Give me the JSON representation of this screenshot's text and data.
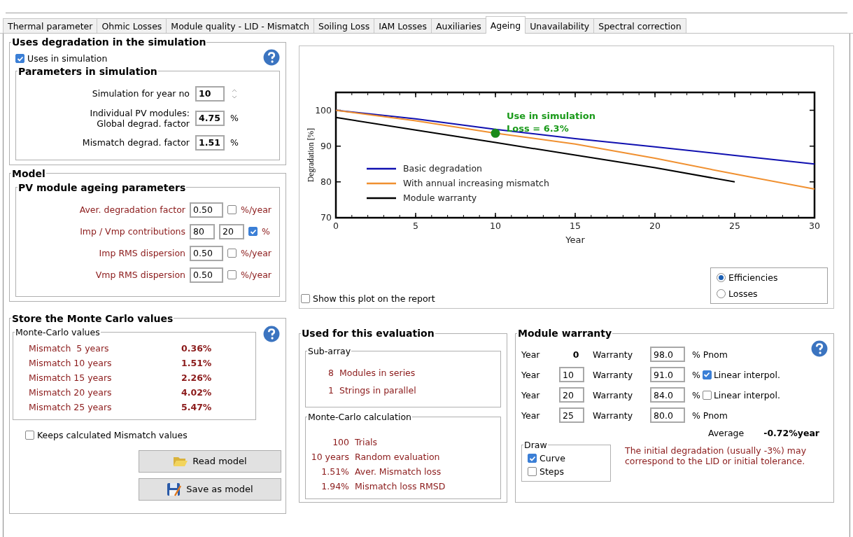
{
  "tabs": [
    {
      "label": "Thermal parameter",
      "selected": false
    },
    {
      "label": "Ohmic Losses",
      "selected": false
    },
    {
      "label": "Module quality - LID - Mismatch",
      "selected": false
    },
    {
      "label": "Soiling Loss",
      "selected": false
    },
    {
      "label": "IAM Losses",
      "selected": false
    },
    {
      "label": "Auxiliaries",
      "selected": false
    },
    {
      "label": "Ageing",
      "selected": true
    },
    {
      "label": "Unavailability",
      "selected": false
    },
    {
      "label": "Spectral correction",
      "selected": false
    }
  ],
  "usage": {
    "title": "Uses degradation in the simulation",
    "use": {
      "label": "Uses in simulation",
      "checked": true
    },
    "params": {
      "title": "Parameters in simulation",
      "rows": [
        {
          "kind": "spin",
          "label": [
            "Simulation for year no"
          ],
          "value": "10"
        },
        {
          "kind": "field",
          "label": [
            "Individual PV modules:",
            "Global degrad. factor"
          ],
          "value": "4.75",
          "unit": "%"
        },
        {
          "kind": "field",
          "label": [
            "Mismatch degrad. factor"
          ],
          "value": "1.51",
          "unit": "%"
        }
      ]
    }
  },
  "model": {
    "title": "Model",
    "subtitle": "PV module ageing parameters",
    "rows": [
      {
        "label": "Aver. degradation factor",
        "values": [
          "0.50"
        ],
        "checked": false,
        "unit": "%/year"
      },
      {
        "label": "Imp / Vmp contributions",
        "values": [
          "80",
          "20"
        ],
        "checked": true,
        "unit": "%"
      },
      {
        "label": "Imp RMS dispersion",
        "values": [
          "0.50"
        ],
        "checked": false,
        "unit": "%/year"
      },
      {
        "label": "Vmp RMS dispersion",
        "values": [
          "0.50"
        ],
        "checked": false,
        "unit": "%/year"
      }
    ]
  },
  "store": {
    "title": "Store the Monte Carlo values",
    "box_title": "Monte-Carlo values",
    "rows": [
      {
        "label": "Mismatch  5 years",
        "value": "0.36%"
      },
      {
        "label": "Mismatch 10 years",
        "value": "1.51%"
      },
      {
        "label": "Mismatch 15 years",
        "value": "2.26%"
      },
      {
        "label": "Mismatch 20 years",
        "value": "4.02%"
      },
      {
        "label": "Mismatch 25 years",
        "value": "5.47%"
      }
    ],
    "keep": {
      "label": "Keeps calculated Mismatch values",
      "checked": false
    },
    "buttons": [
      {
        "kind": "open",
        "label": "Read model"
      },
      {
        "kind": "save",
        "label": "Save as model"
      }
    ]
  },
  "plot": {
    "chart_data": {
      "type": "line",
      "xlabel": "Year",
      "ylabel": "Degradation [%]",
      "x": [
        0,
        5,
        10,
        15,
        20,
        25,
        30
      ],
      "series": [
        {
          "name": "Basic degradation",
          "color": "#1010b0",
          "values": [
            100,
            97.6,
            94.7,
            92.1,
            89.8,
            87.4,
            85
          ]
        },
        {
          "name": "With annual increasing mismatch",
          "color": "#f09030",
          "values": [
            100,
            97.1,
            93.6,
            90.6,
            86.6,
            82.2,
            78
          ]
        },
        {
          "name": "Module warranty",
          "color": "#000000",
          "values": [
            98,
            94.5,
            91,
            87.5,
            84,
            80,
            null
          ]
        }
      ],
      "xlim": [
        0,
        30
      ],
      "ylim": [
        70,
        105
      ],
      "xticks": [
        0,
        5,
        10,
        15,
        20,
        25,
        30
      ],
      "yticks": [
        70,
        80,
        90,
        100
      ],
      "legend": "lower left",
      "annotations": [
        "Use in simulation",
        "Loss = 6.3%"
      ]
    },
    "show_on_report": {
      "label": "Show this plot on the report",
      "checked": false
    },
    "modes": [
      {
        "label": "Efficiencies",
        "selected": true
      },
      {
        "label": "Losses",
        "selected": false
      }
    ]
  },
  "evaluation": {
    "title": "Used for this evaluation",
    "subarray": {
      "title": "Sub-array",
      "rows": [
        {
          "value": "8",
          "label": "Modules in series"
        },
        {
          "value": "1",
          "label": "Strings in parallel"
        }
      ]
    },
    "calc": {
      "title": "Monte-Carlo calculation",
      "rows": [
        {
          "amount": "100",
          "description": "Trials"
        },
        {
          "amount": "10 years",
          "description": "Random evaluation"
        },
        {
          "amount": "1.51%",
          "description": "Aver. Mismatch loss"
        },
        {
          "amount": "1.94%",
          "description": "Mismatch loss RMSD"
        }
      ]
    }
  },
  "warranty": {
    "title": "Module warranty",
    "rows": [
      {
        "kind": "fixed",
        "year_label": "Year",
        "year": "0",
        "warranty_label": "Warranty",
        "value": "98.0",
        "unit": "% Pnom"
      },
      {
        "kind": "input",
        "year_label": "Year",
        "year": "10",
        "warranty_label": "Warranty",
        "value": "91.0",
        "unit": "%",
        "interpolation": {
          "label": "Linear interpol.",
          "checked": true
        }
      },
      {
        "kind": "input",
        "year_label": "Year",
        "year": "20",
        "warranty_label": "Warranty",
        "value": "84.0",
        "unit": "%",
        "interpolation": {
          "label": "Linear interpol.",
          "checked": false
        }
      },
      {
        "kind": "input",
        "year_label": "Year",
        "year": "25",
        "warranty_label": "Warranty",
        "value": "80.0",
        "unit": "% Pnom"
      }
    ],
    "average": {
      "label": "Average",
      "value": "-0.72%year"
    },
    "draw": {
      "title": "Draw",
      "options": [
        {
          "label": "Curve",
          "checked": true
        },
        {
          "label": "Steps",
          "checked": false
        }
      ]
    },
    "note": "The initial degradation (usually -3%) may correspond to the LID or initial tolerance."
  }
}
